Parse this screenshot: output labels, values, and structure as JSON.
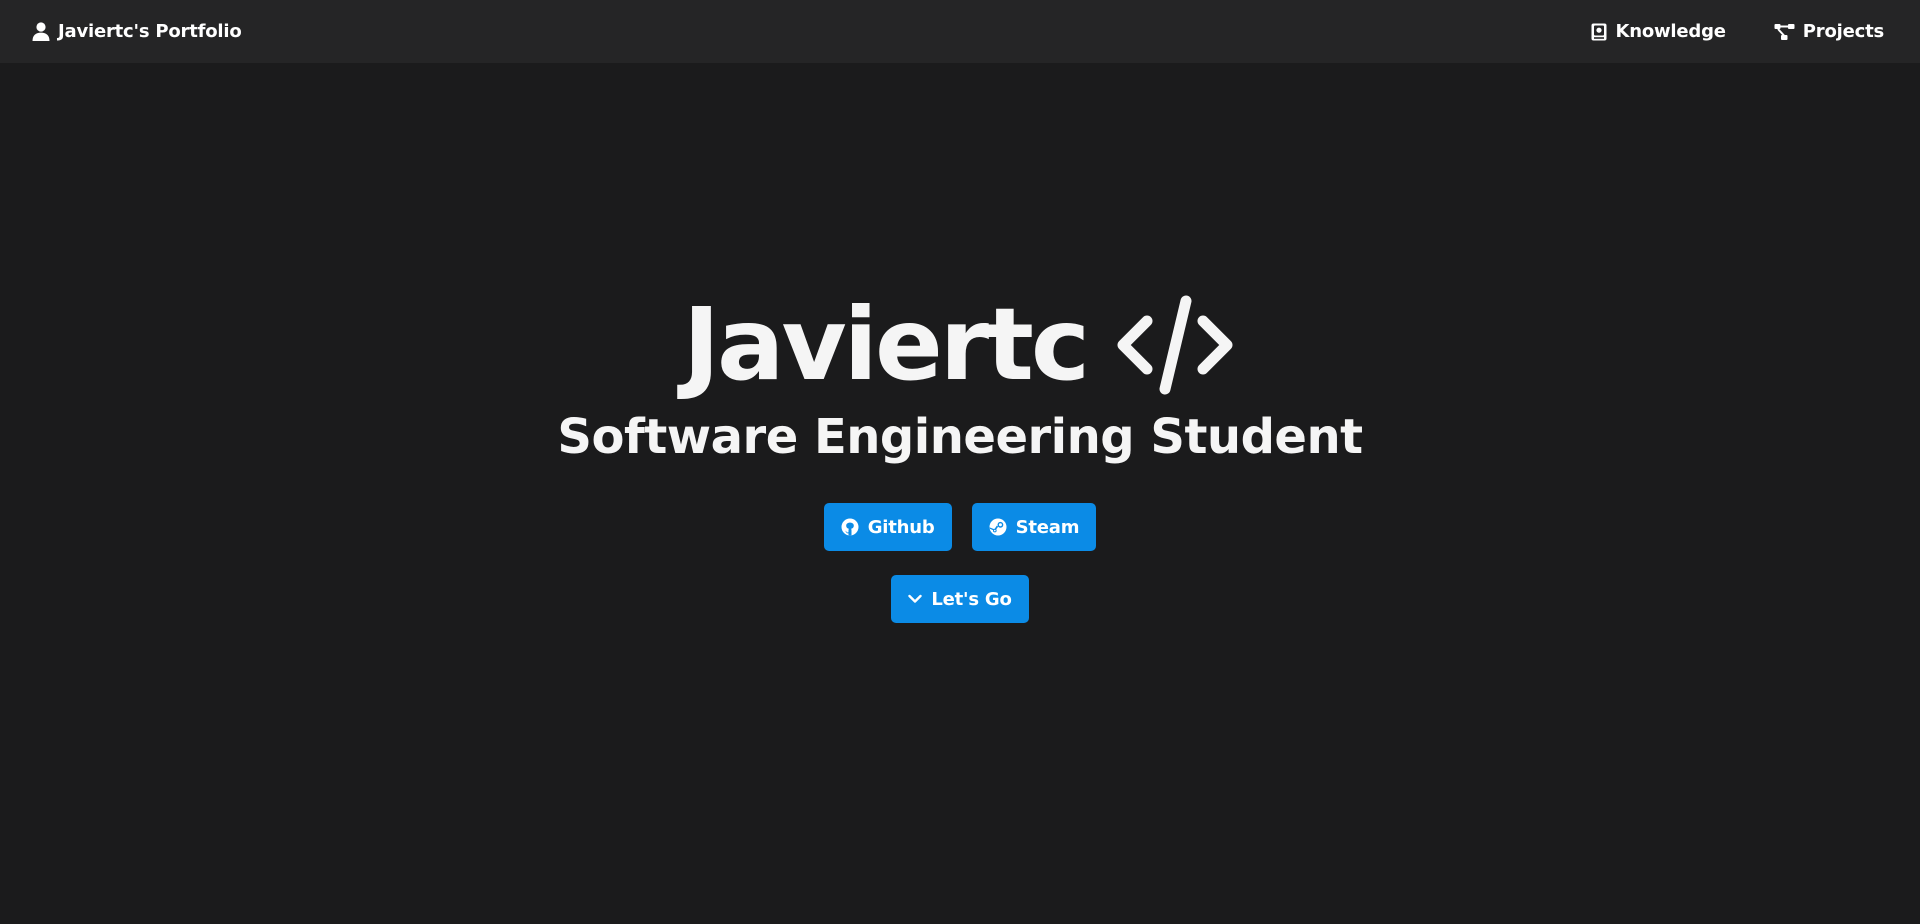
{
  "nav": {
    "brand_icon": "user-icon",
    "brand_label": "Javiertc's Portfolio",
    "links": [
      {
        "icon": "book-icon",
        "label": "Knowledge"
      },
      {
        "icon": "sitemap-icon",
        "label": "Projects"
      }
    ]
  },
  "hero": {
    "title": "Javiertc",
    "title_icon": "code-icon",
    "subtitle": "Software Engineering Student",
    "buttons": [
      {
        "icon": "github-icon",
        "label": "Github"
      },
      {
        "icon": "steam-icon",
        "label": "Steam"
      }
    ],
    "cta": {
      "icon": "chevron-down-icon",
      "label": "Let's Go"
    }
  },
  "colors": {
    "background": "#1b1b1c",
    "navbar": "#252526",
    "accent": "#0b8be6",
    "text": "#f5f5f5"
  }
}
